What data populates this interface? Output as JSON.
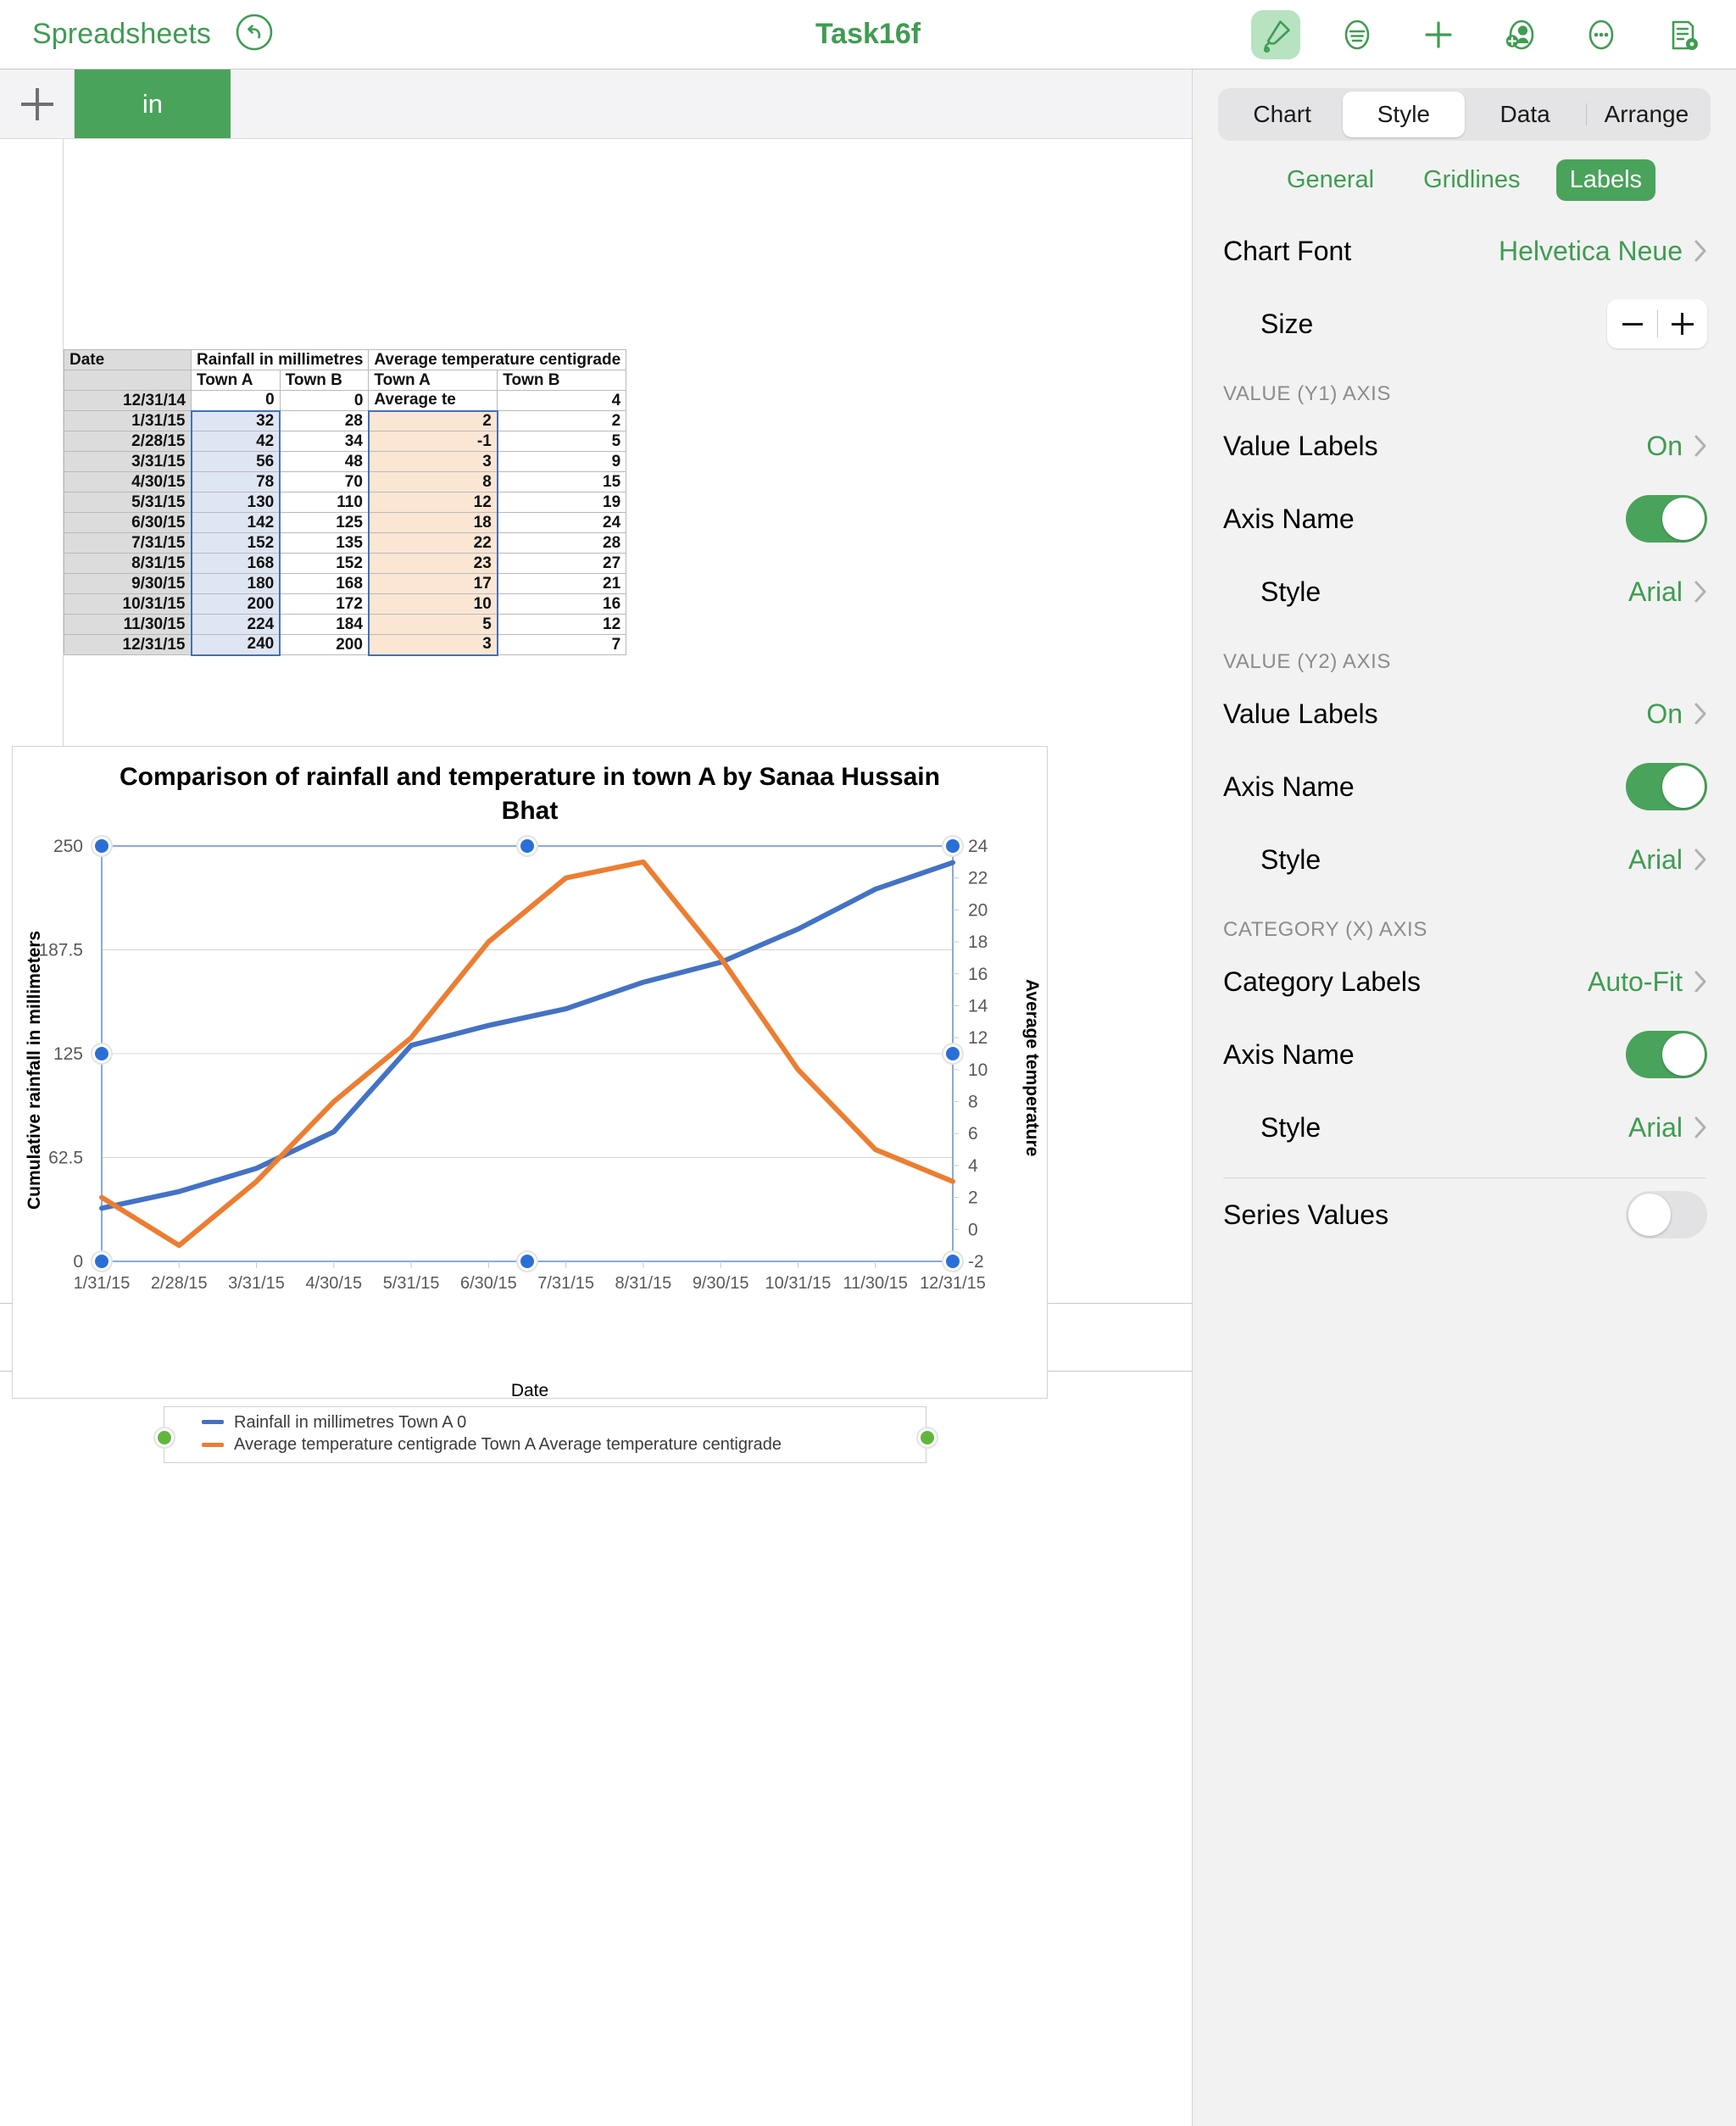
{
  "topbar": {
    "back_label": "Spreadsheets",
    "undo_icon": "undo-icon",
    "doc_title": "Task16f",
    "icons": [
      {
        "name": "format-brush-icon",
        "active": true
      },
      {
        "name": "insert-paragraph-icon",
        "active": false
      },
      {
        "name": "add-icon",
        "active": false
      },
      {
        "name": "collaborate-add-person-icon",
        "active": false
      },
      {
        "name": "more-options-icon",
        "active": false
      },
      {
        "name": "document-options-icon",
        "active": false
      }
    ]
  },
  "sheettabs": {
    "add_label": "+",
    "tabs": [
      {
        "label": "in",
        "selected": true
      }
    ]
  },
  "sheet": {
    "headers_top": [
      "Date",
      "Rainfall in millimetres",
      "Average temperature centigrade"
    ],
    "headers_sub": [
      "",
      "Town A",
      "Town B",
      "Town A",
      "Town B"
    ],
    "rows": [
      {
        "date": "12/31/14",
        "rain_a": "0",
        "rain_b": "0",
        "temp_a": "Average te",
        "temp_b": "4"
      },
      {
        "date": "1/31/15",
        "rain_a": "32",
        "rain_b": "28",
        "temp_a": "2",
        "temp_b": "2"
      },
      {
        "date": "2/28/15",
        "rain_a": "42",
        "rain_b": "34",
        "temp_a": "-1",
        "temp_b": "5"
      },
      {
        "date": "3/31/15",
        "rain_a": "56",
        "rain_b": "48",
        "temp_a": "3",
        "temp_b": "9"
      },
      {
        "date": "4/30/15",
        "rain_a": "78",
        "rain_b": "70",
        "temp_a": "8",
        "temp_b": "15"
      },
      {
        "date": "5/31/15",
        "rain_a": "130",
        "rain_b": "110",
        "temp_a": "12",
        "temp_b": "19"
      },
      {
        "date": "6/30/15",
        "rain_a": "142",
        "rain_b": "125",
        "temp_a": "18",
        "temp_b": "24"
      },
      {
        "date": "7/31/15",
        "rain_a": "152",
        "rain_b": "135",
        "temp_a": "22",
        "temp_b": "28"
      },
      {
        "date": "8/31/15",
        "rain_a": "168",
        "rain_b": "152",
        "temp_a": "23",
        "temp_b": "27"
      },
      {
        "date": "9/30/15",
        "rain_a": "180",
        "rain_b": "168",
        "temp_a": "17",
        "temp_b": "21"
      },
      {
        "date": "10/31/15",
        "rain_a": "200",
        "rain_b": "172",
        "temp_a": "10",
        "temp_b": "16"
      },
      {
        "date": "11/30/15",
        "rain_a": "224",
        "rain_b": "184",
        "temp_a": "5",
        "temp_b": "12"
      },
      {
        "date": "12/31/15",
        "rain_a": "240",
        "rain_b": "200",
        "temp_a": "3",
        "temp_b": "7"
      }
    ]
  },
  "chart_data": {
    "type": "line",
    "title": "Comparison of rainfall and temperature in town A by Sanaa Hussain Bhat",
    "xlabel": "Date",
    "ylabel": "Cumulative rainfall in millimeters",
    "y2label": "Average temperature",
    "categories": [
      "1/31/15",
      "2/28/15",
      "3/31/15",
      "4/30/15",
      "5/31/15",
      "6/30/15",
      "7/31/15",
      "8/31/15",
      "9/30/15",
      "10/31/15",
      "11/30/15",
      "12/31/15"
    ],
    "y_ticks": [
      "0",
      "62.5",
      "125",
      "187.5",
      "250"
    ],
    "ylim": [
      0,
      250
    ],
    "y2_ticks": [
      "-2",
      "0",
      "2",
      "4",
      "6",
      "8",
      "10",
      "12",
      "14",
      "16",
      "18",
      "20",
      "22",
      "24"
    ],
    "y2lim": [
      -2,
      24
    ],
    "grid": true,
    "legend_position": "bottom",
    "series": [
      {
        "name": "Rainfall in millimetres Town A 0",
        "color": "#4472c4",
        "axis": "y1",
        "values": [
          32,
          42,
          56,
          78,
          130,
          142,
          152,
          168,
          180,
          200,
          224,
          240
        ]
      },
      {
        "name": "Average temperature centigrade Town A Average temperature centigrade",
        "color": "#ed7d31",
        "axis": "y2",
        "values": [
          2,
          -1,
          3,
          8,
          12,
          18,
          22,
          23,
          17,
          10,
          5,
          3
        ]
      }
    ]
  },
  "inspector": {
    "tabs": [
      {
        "label": "Chart",
        "selected": false
      },
      {
        "label": "Style",
        "selected": true
      },
      {
        "label": "Data",
        "selected": false
      },
      {
        "label": "Arrange",
        "selected": false
      }
    ],
    "subtabs": [
      {
        "label": "General",
        "selected": false
      },
      {
        "label": "Gridlines",
        "selected": false
      },
      {
        "label": "Labels",
        "selected": true
      }
    ],
    "chart_font": {
      "label": "Chart Font",
      "value": "Helvetica Neue"
    },
    "size": {
      "label": "Size",
      "minus": "−",
      "plus": "+"
    },
    "sections": [
      {
        "heading": "VALUE (Y1) AXIS",
        "value_labels": {
          "label": "Value Labels",
          "value": "On"
        },
        "axis_name": {
          "label": "Axis Name",
          "on": true
        },
        "style": {
          "label": "Style",
          "value": "Arial"
        }
      },
      {
        "heading": "VALUE (Y2) AXIS",
        "value_labels": {
          "label": "Value Labels",
          "value": "On"
        },
        "axis_name": {
          "label": "Axis Name",
          "on": true
        },
        "style": {
          "label": "Style",
          "value": "Arial"
        }
      },
      {
        "heading": "CATEGORY (X) AXIS",
        "value_labels": {
          "label": "Category Labels",
          "value": "Auto-Fit"
        },
        "axis_name": {
          "label": "Axis Name",
          "on": true
        },
        "style": {
          "label": "Style",
          "value": "Arial"
        }
      }
    ],
    "series_values": {
      "label": "Series Values",
      "on": false
    }
  },
  "colors": {
    "accent_green": "#3f9c52",
    "tab_green": "#4aa35b",
    "series1": "#4472c4",
    "series2": "#ed7d31",
    "handle_blue": "#2a6fd6",
    "handle_green": "#62b53c"
  }
}
